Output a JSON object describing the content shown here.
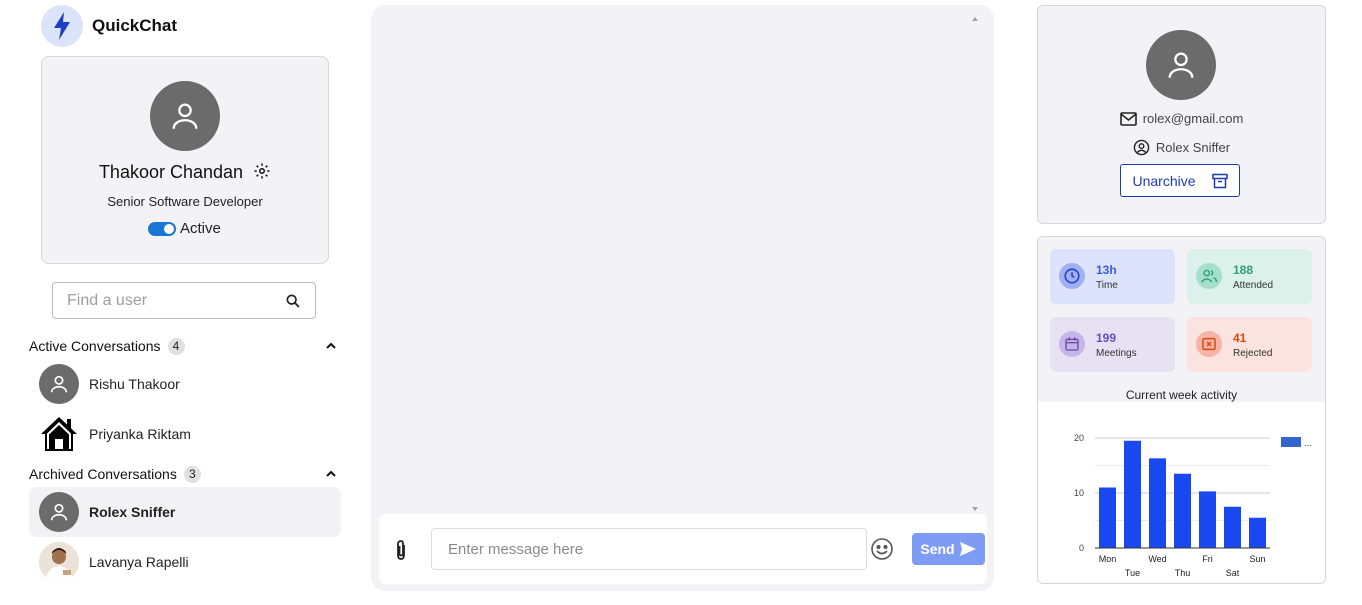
{
  "app": {
    "name": "QuickChat"
  },
  "profile": {
    "name": "Thakoor Chandan",
    "role": "Senior Software Developer",
    "status": "Active"
  },
  "search": {
    "placeholder": "Find a user"
  },
  "active_section": {
    "title": "Active Conversations",
    "count": "4"
  },
  "active_conversations": [
    {
      "name": "Rishu Thakoor",
      "avatar": "user-icon"
    },
    {
      "name": "Priyanka Riktam",
      "avatar": "house-icon"
    }
  ],
  "archived_section": {
    "title": "Archived Conversations",
    "count": "3"
  },
  "archived_conversations": [
    {
      "name": "Rolex Sniffer",
      "avatar": "user-icon",
      "selected": true
    },
    {
      "name": "Lavanya Rapelli",
      "avatar": "photo"
    }
  ],
  "chat": {
    "placeholder": "Enter message here",
    "send_label": "Send"
  },
  "contact": {
    "email": "rolex@gmail.com",
    "username": "Rolex Sniffer",
    "unarchive_label": "Unarchive"
  },
  "stats": [
    {
      "value": "13h",
      "label": "Time",
      "color": "#3b5bdb",
      "bg": "#dde3fb",
      "icon": "clock-icon"
    },
    {
      "value": "188",
      "label": "Attended",
      "color": "#2f9e7a",
      "bg": "#dbf1ea",
      "icon": "users-icon"
    },
    {
      "value": "199",
      "label": "Meetings",
      "color": "#6a4cb8",
      "bg": "#e6e1f3",
      "icon": "calendar-icon"
    },
    {
      "value": "41",
      "label": "Rejected",
      "color": "#d9480f",
      "bg": "#fbe3df",
      "icon": "reject-icon"
    }
  ],
  "chart_data": {
    "type": "bar",
    "title": "Current week activity",
    "categories": [
      "Mon",
      "Tue",
      "Wed",
      "Thu",
      "Fri",
      "Sat",
      "Sun"
    ],
    "values": [
      11,
      19.5,
      16.3,
      13.5,
      10.3,
      7.5,
      5.5
    ],
    "ylim": [
      0,
      20
    ],
    "yticks": [
      0,
      10,
      20
    ],
    "bar_color": "#1a48f0",
    "legend": {
      "position": "right",
      "label": "..."
    }
  }
}
